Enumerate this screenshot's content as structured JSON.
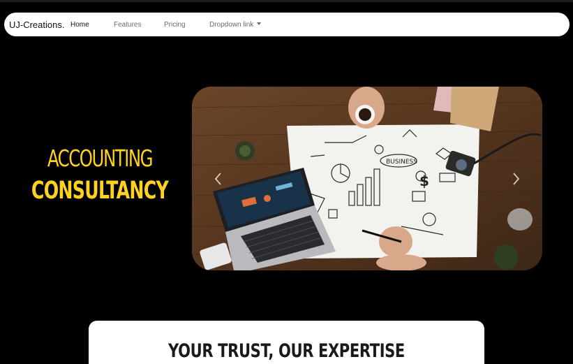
{
  "navbar": {
    "brand": "UJ-Creations.",
    "links": [
      {
        "label": "Home",
        "active": true
      },
      {
        "label": "Features",
        "active": false
      },
      {
        "label": "Pricing",
        "active": false
      },
      {
        "label": "Dropdown link",
        "active": false,
        "dropdown": true
      }
    ]
  },
  "hero": {
    "line1": "ACCOUNTING",
    "line2": "CONSULTANCY",
    "accent_color": "#ffd21f"
  },
  "carousel": {
    "image_description_icon": "business-desk-photo",
    "prev_icon": "chevron-left-icon",
    "next_icon": "chevron-right-icon",
    "sketch_label": "BUSINESS"
  },
  "section": {
    "title": "YOUR TRUST, OUR EXPERTISE"
  }
}
